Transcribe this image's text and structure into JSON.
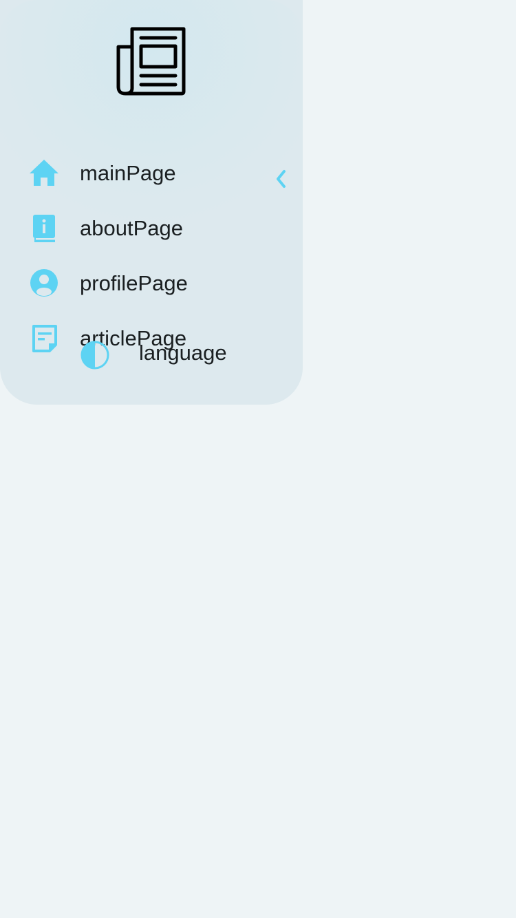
{
  "drawer": {
    "logo_icon": "newspaper-icon",
    "collapse_icon": "chevron-left-icon",
    "items": [
      {
        "label": "mainPage",
        "icon": "home-icon"
      },
      {
        "label": "aboutPage",
        "icon": "info-book-icon"
      },
      {
        "label": "profilePage",
        "icon": "account-circle-icon"
      },
      {
        "label": "articlePage",
        "icon": "sticky-note-icon"
      }
    ],
    "language": {
      "label": "language",
      "icon": "contrast-icon"
    }
  },
  "colors": {
    "accent": "#5dd3f3",
    "background": "#eef4f6",
    "drawer": "#dde9ee",
    "text": "#1a1f21"
  }
}
